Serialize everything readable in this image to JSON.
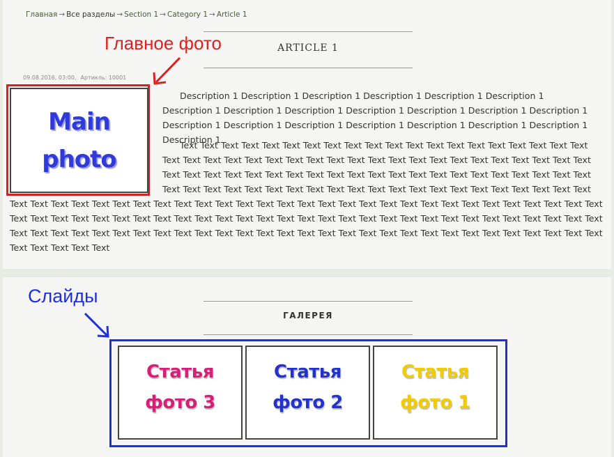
{
  "breadcrumb": {
    "items": [
      "Главная",
      "Все разделы",
      "Section 1",
      "Category 1",
      "Article 1"
    ],
    "separator": "→"
  },
  "article": {
    "title": "ARTICLE 1",
    "date": "09.08.2016, 03:00,",
    "sku": "Артикль: 10001",
    "description": "Description 1 Description 1 Description 1 Description 1 Description 1 Description 1 Description 1 Description 1 Description 1 Description 1 Description 1 Description 1 Description 1 Description 1 Description 1 Description 1 Description 1 Description 1 Description 1 Description 1 Description 1",
    "body": "Text Text Text Text Text Text Text Text Text Text Text Text Text Text Text Text Text Text Text Text Text Text Text Text Text Text Text Text Text Text Text Text Text Text Text Text Text Text Text Text Text Text Text Text Text Text Text Text Text Text Text Text Text Text Text Text Text Text Text Text Text Text Text Text Text Text Text Text Text Text Text Text Text Text Text Text Text Text Text Text Text Text Text Text Text Text Text Text Text Text Text Text Text Text Text Text Text Text Text Text Text Text Text Text Text Text Text Text Text Text Text Text Text Text Text Text Text Text Text Text Text Text Text Text Text Text Text Text Text Text Text Text Text Text Text Text Text Text Text Text Text Text Text Text Text Text Text Text Text Text Text Text Text Text Text Text Text Text Text Text Text Text Text Text Text Text Text Text Text Text Text Text Text Text Text",
    "main_photo_line1": "Main",
    "main_photo_line2": "photo"
  },
  "annotations": {
    "main_photo": "Главное фото",
    "slides": "Слайды",
    "red": "#e02020",
    "blue": "#1d2fe0"
  },
  "gallery": {
    "title": "ГАЛЕРЕЯ",
    "slides": [
      {
        "line1": "Статья",
        "line2": "фото 3",
        "color": "#d81e78"
      },
      {
        "line1": "Статья",
        "line2": "фото 2",
        "color": "#2233cc"
      },
      {
        "line1": "Статья",
        "line2": "фото 1",
        "color": "#f0cc00"
      }
    ]
  }
}
